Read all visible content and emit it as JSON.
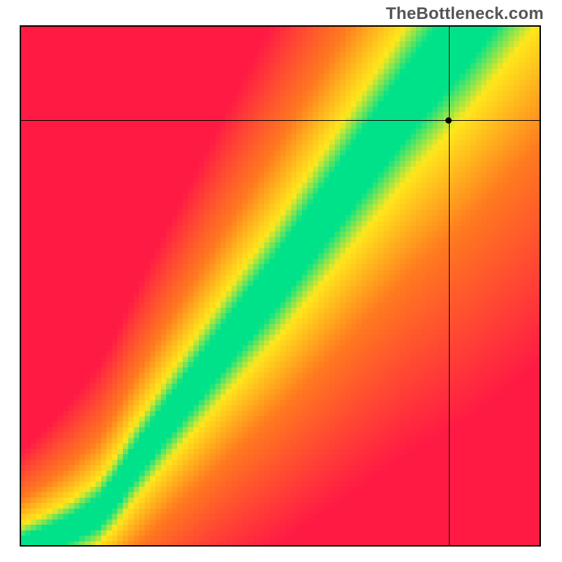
{
  "watermark": "TheBottleneck.com",
  "chart_data": {
    "type": "heatmap",
    "title": "",
    "xlabel": "",
    "ylabel": "",
    "xlim": [
      0,
      1
    ],
    "ylim": [
      0,
      1
    ],
    "grid": false,
    "legend": null,
    "crosshair": {
      "x": 0.823,
      "y": 0.818
    },
    "marker": {
      "x": 0.823,
      "y": 0.818
    },
    "ridge_curve": {
      "description": "Green optimal band runs from bottom-left to top-right; knee near x≈0.18, then steep rise. Color gradient: red (far from ridge) → orange → yellow → green (on ridge).",
      "points": [
        {
          "x": 0.0,
          "y": 0.0
        },
        {
          "x": 0.05,
          "y": 0.015
        },
        {
          "x": 0.1,
          "y": 0.035
        },
        {
          "x": 0.15,
          "y": 0.065
        },
        {
          "x": 0.18,
          "y": 0.1
        },
        {
          "x": 0.22,
          "y": 0.16
        },
        {
          "x": 0.28,
          "y": 0.24
        },
        {
          "x": 0.35,
          "y": 0.33
        },
        {
          "x": 0.42,
          "y": 0.42
        },
        {
          "x": 0.5,
          "y": 0.52
        },
        {
          "x": 0.58,
          "y": 0.63
        },
        {
          "x": 0.66,
          "y": 0.74
        },
        {
          "x": 0.74,
          "y": 0.85
        },
        {
          "x": 0.82,
          "y": 0.95
        },
        {
          "x": 0.86,
          "y": 1.0
        }
      ],
      "band_halfwidth_start": 0.018,
      "band_halfwidth_end": 0.085
    },
    "color_stops": {
      "red": "#ff1a44",
      "orange": "#ff7a1f",
      "yellow": "#ffe71c",
      "green": "#00e28a"
    },
    "pixel_grid": 96
  }
}
